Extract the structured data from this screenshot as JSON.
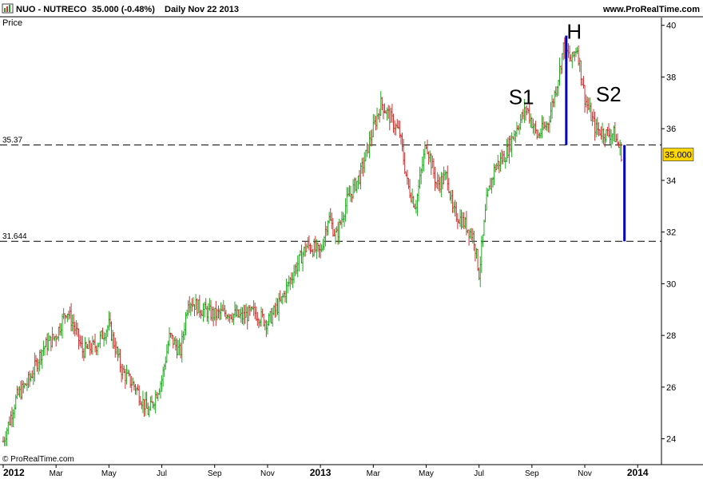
{
  "header": {
    "symbol_line": "NUO - NUTRECO",
    "price_change": "35.000 (-0.48%)",
    "timeframe_date": "Daily  Nov 22 2013",
    "website": "www.ProRealTime.com"
  },
  "copyright": "© ProRealTime.com",
  "colors": {
    "up_bar": "#22aa22",
    "down_bar": "#cc3333",
    "annotation": "#0000cc",
    "price_badge_bg": "#ffd700",
    "frame": "#000000"
  },
  "icons": [
    "chart-icon"
  ],
  "chart_data": {
    "type": "line",
    "style": "ohlc-bars",
    "ylabel": "Price",
    "y_ticks": [
      24,
      26,
      28,
      30,
      32,
      34,
      36,
      38,
      40
    ],
    "ylim": [
      23.0,
      40.3
    ],
    "x_ticks": [
      "2012",
      "Mar",
      "May",
      "Jul",
      "Sep",
      "Nov",
      "2013",
      "Mar",
      "May",
      "Jul",
      "Sep",
      "Nov",
      "2014"
    ],
    "x_tick_months": [
      0,
      2,
      4,
      6,
      8,
      10,
      12,
      14,
      16,
      18,
      20,
      22,
      24
    ],
    "xlim_months": [
      0,
      24.9
    ],
    "last_price": "35.000",
    "price_path": [
      [
        0.0,
        23.9
      ],
      [
        0.5,
        25.6
      ],
      [
        1.0,
        26.3
      ],
      [
        1.5,
        27.5
      ],
      [
        2.0,
        28.0
      ],
      [
        2.4,
        29.0
      ],
      [
        2.7,
        28.3
      ],
      [
        3.0,
        27.4
      ],
      [
        3.5,
        27.6
      ],
      [
        4.0,
        28.4
      ],
      [
        4.5,
        26.6
      ],
      [
        5.0,
        26.0
      ],
      [
        5.5,
        25.0
      ],
      [
        6.0,
        26.3
      ],
      [
        6.3,
        28.0
      ],
      [
        6.7,
        27.3
      ],
      [
        7.0,
        29.4
      ],
      [
        7.5,
        29.0
      ],
      [
        8.0,
        28.8
      ],
      [
        8.5,
        28.9
      ],
      [
        9.0,
        28.7
      ],
      [
        9.5,
        28.9
      ],
      [
        10.0,
        28.5
      ],
      [
        10.5,
        29.3
      ],
      [
        11.0,
        30.5
      ],
      [
        11.5,
        31.5
      ],
      [
        12.0,
        31.2
      ],
      [
        12.3,
        32.6
      ],
      [
        12.6,
        31.8
      ],
      [
        13.0,
        33.2
      ],
      [
        13.5,
        34.2
      ],
      [
        14.0,
        36.0
      ],
      [
        14.3,
        37.0
      ],
      [
        14.6,
        36.5
      ],
      [
        15.0,
        35.8
      ],
      [
        15.3,
        33.8
      ],
      [
        15.6,
        33.0
      ],
      [
        16.0,
        35.5
      ],
      [
        16.4,
        33.8
      ],
      [
        16.8,
        34.2
      ],
      [
        17.0,
        32.8
      ],
      [
        17.4,
        32.4
      ],
      [
        17.8,
        31.8
      ],
      [
        18.0,
        30.4
      ],
      [
        18.3,
        33.3
      ],
      [
        18.6,
        34.5
      ],
      [
        19.0,
        35.0
      ],
      [
        19.4,
        36.0
      ],
      [
        19.8,
        36.8
      ],
      [
        20.2,
        35.7
      ],
      [
        20.6,
        36.2
      ],
      [
        21.0,
        38.0
      ],
      [
        21.2,
        39.2
      ],
      [
        21.5,
        38.6
      ],
      [
        21.7,
        39.2
      ],
      [
        22.0,
        37.2
      ],
      [
        22.4,
        36.0
      ],
      [
        22.8,
        35.8
      ],
      [
        23.1,
        35.8
      ],
      [
        23.4,
        35.0
      ]
    ],
    "levels": [
      {
        "label": "35.37",
        "value": 35.37
      },
      {
        "label": "31.644",
        "value": 31.644
      }
    ],
    "annotations": {
      "shoulder_1": "S1",
      "head": "H",
      "shoulder_2": "S2"
    },
    "head_height_segment": {
      "month": 21.3,
      "from": 35.37,
      "to": 39.6
    },
    "target_segment": {
      "month": 23.5,
      "from": 35.37,
      "to": 31.644
    }
  }
}
